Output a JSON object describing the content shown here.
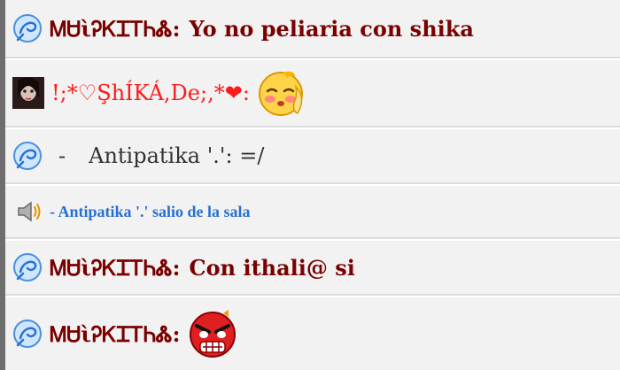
{
  "messages": [
    {
      "icon": "swirl-icon",
      "name": "ᎷᏌὶᎮᏦᏆᎢᏂᏜ:",
      "text": "Yo no peliaria con shika"
    },
    {
      "icon": "avatar",
      "name": "!;*♡ŞhÍKÁ,De;,*❤:",
      "emoji": "blushing-face-emoji"
    },
    {
      "icon": "swirl-icon",
      "dash": "-",
      "text": "Antipatika '.': =/"
    },
    {
      "icon": "speaker-icon",
      "text": "- Antipatika '.' salio de la sala"
    },
    {
      "icon": "swirl-icon",
      "name": "ᎷᏌὶᎮᏦᏆᎢᏂᏜ:",
      "text": "Con ithali@ si"
    },
    {
      "icon": "swirl-icon",
      "name": "ᎷᏌὶᎮᏦᏆᎢᏂᏜ:",
      "emoji": "angry-face-emoji"
    }
  ],
  "colors": {
    "name_dark": "#7a0000",
    "name_red": "#ff1a1a",
    "system_blue": "#2a6fcf",
    "row_bg": "#f2f2f2"
  }
}
